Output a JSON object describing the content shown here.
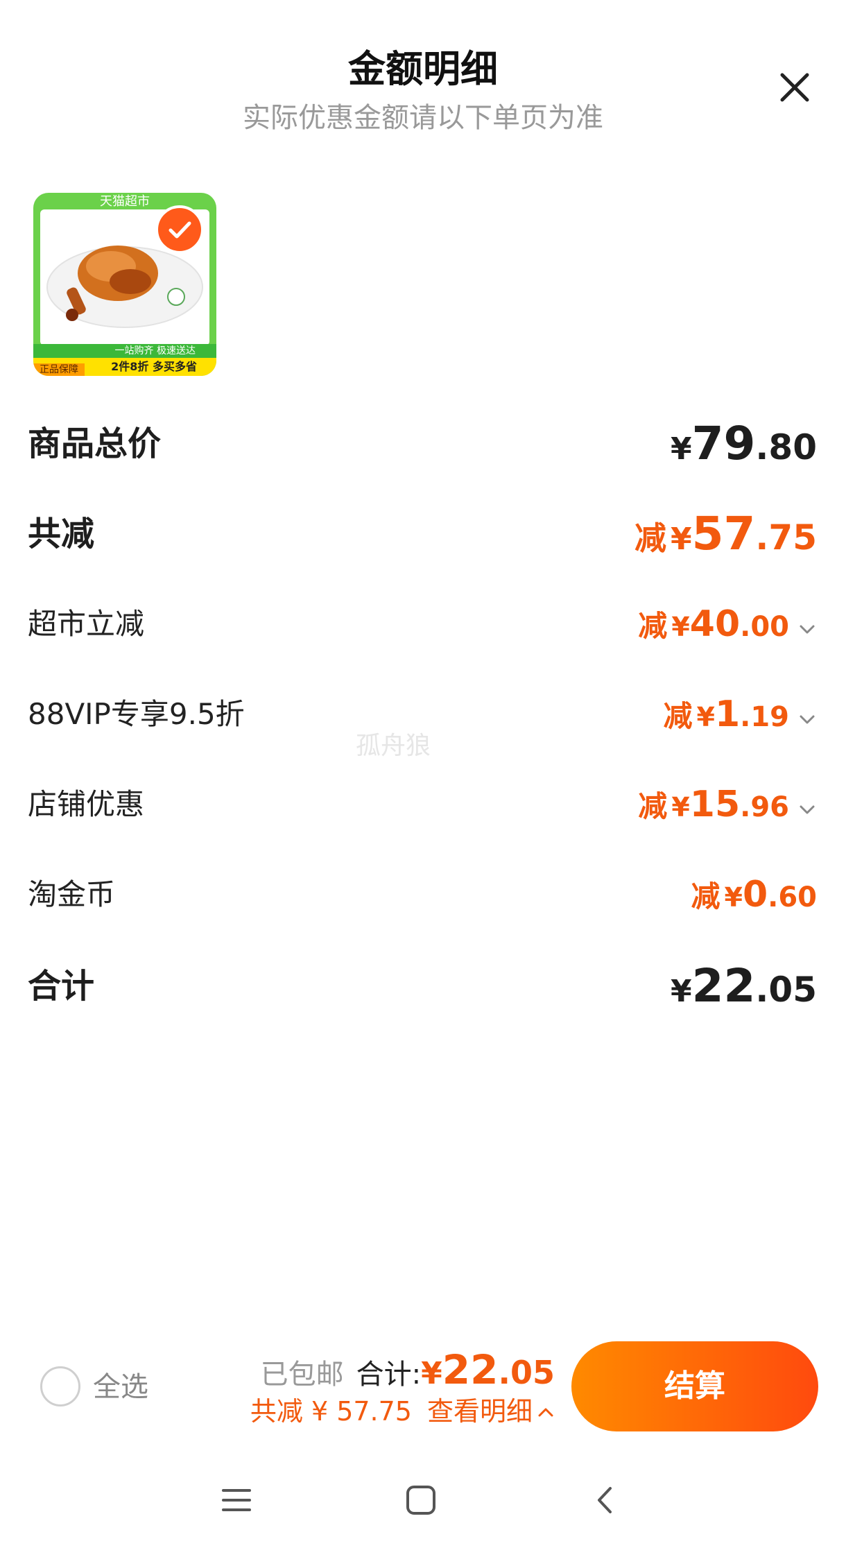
{
  "header": {
    "title": "金额明细",
    "subtitle": "实际优惠金额请以下单页为准"
  },
  "product": {
    "top_band": "天猫超市",
    "bottom_band": "一站购齐 极速送达",
    "promo_band": "2件8折 多买多省",
    "badge": "正品保障",
    "checked": true
  },
  "rows": {
    "subtotal": {
      "label": "商品总价",
      "yen": "¥",
      "int": "79",
      "dec": ".80"
    },
    "total_discount": {
      "label": "共减",
      "prefix": "减",
      "yen": "¥",
      "int": "57",
      "dec": ".75"
    },
    "discounts": [
      {
        "label": "超市立减",
        "prefix": "减",
        "yen": "¥",
        "int": "40",
        "dec": ".00",
        "expandable": true
      },
      {
        "label": "88VIP专享9.5折",
        "prefix": "减",
        "yen": "¥",
        "int": "1",
        "dec": ".19",
        "expandable": true
      },
      {
        "label": "店铺优惠",
        "prefix": "减",
        "yen": "¥",
        "int": "15",
        "dec": ".96",
        "expandable": true
      },
      {
        "label": "淘金币",
        "prefix": "减",
        "yen": "¥",
        "int": "0",
        "dec": ".60",
        "expandable": false
      }
    ],
    "total": {
      "label": "合计",
      "yen": "¥",
      "int": "22",
      "dec": ".05"
    }
  },
  "watermark": "孤舟狼",
  "bottom_bar": {
    "select_all": "全选",
    "shipping": "已包邮",
    "total_label": "合计:",
    "total_yen": "¥",
    "total_int": "22",
    "total_dec": ".05",
    "discount_text": "共减 ¥ 57.75",
    "details_link": "查看明细",
    "checkout": "结算"
  },
  "colors": {
    "accent": "#f25a0e",
    "checkout_gradient_start": "#ff8a00",
    "checkout_gradient_end": "#ff4a0e"
  },
  "icons": [
    "close-icon",
    "check-icon",
    "chevron-down-icon",
    "chevron-up-icon",
    "menu-icon",
    "home-icon",
    "back-icon"
  ]
}
